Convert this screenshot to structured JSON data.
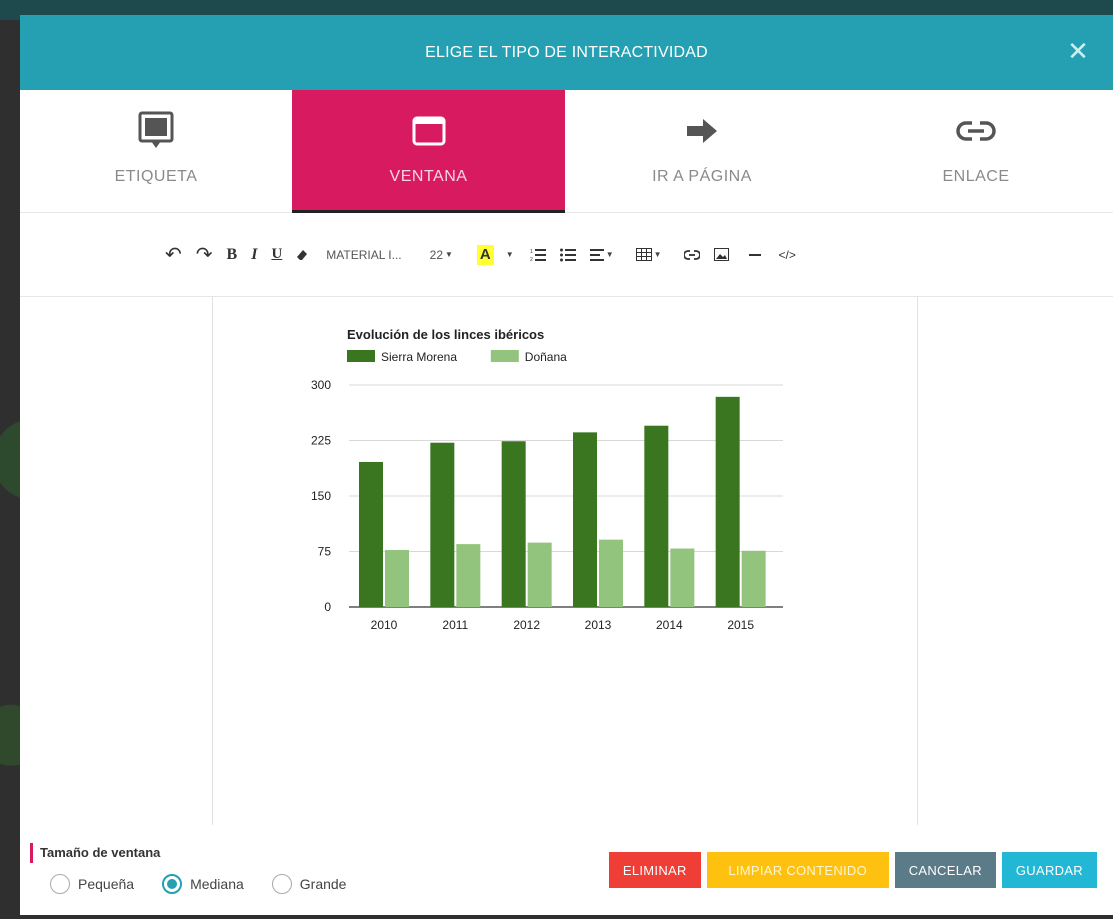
{
  "modal": {
    "title": "ELIGE EL TIPO DE INTERACTIVIDAD",
    "close_glyph": "✕"
  },
  "tabs": [
    {
      "label": "ETIQUETA",
      "icon": "speech-bubble-icon",
      "active": false
    },
    {
      "label": "VENTANA",
      "icon": "window-icon",
      "active": true
    },
    {
      "label": "IR A PÁGINA",
      "icon": "arrow-right-icon",
      "active": false
    },
    {
      "label": "ENLACE",
      "icon": "link-icon",
      "active": false
    }
  ],
  "toolbar": {
    "undo": "↶",
    "redo": "↷",
    "bold": "B",
    "italic": "I",
    "underline": "U",
    "font_name": "MATERIAL I...",
    "font_size": "22",
    "color_letter": "A",
    "code": "</>"
  },
  "chart_data": {
    "type": "bar",
    "title": "Evolución de los linces ibéricos",
    "categories": [
      "2010",
      "2011",
      "2012",
      "2013",
      "2014",
      "2015"
    ],
    "series": [
      {
        "name": "Sierra Morena",
        "color": "#3a761f",
        "values": [
          196,
          222,
          224,
          236,
          245,
          284
        ]
      },
      {
        "name": "Doñana",
        "color": "#93c47d",
        "values": [
          77,
          85,
          87,
          91,
          79,
          76
        ]
      }
    ],
    "yticks": [
      "300",
      "225",
      "150",
      "75",
      "0"
    ],
    "ylim": [
      0,
      300
    ],
    "grid": true,
    "legend_position": "top-left"
  },
  "window_size": {
    "label": "Tamaño de ventana",
    "options": [
      {
        "label": "Pequeña",
        "checked": false
      },
      {
        "label": "Mediana",
        "checked": true
      },
      {
        "label": "Grande",
        "checked": false
      }
    ]
  },
  "buttons": {
    "delete": "ELIMINAR",
    "clear": "LIMPIAR CONTENIDO",
    "cancel": "CANCELAR",
    "save": "GUARDAR"
  },
  "colors": {
    "header": "#24a0b2",
    "active_tab": "#d81b60",
    "delete": "#ef3e36",
    "clear": "#fec110",
    "cancel": "#5b7b88",
    "save": "#22b7d4"
  }
}
